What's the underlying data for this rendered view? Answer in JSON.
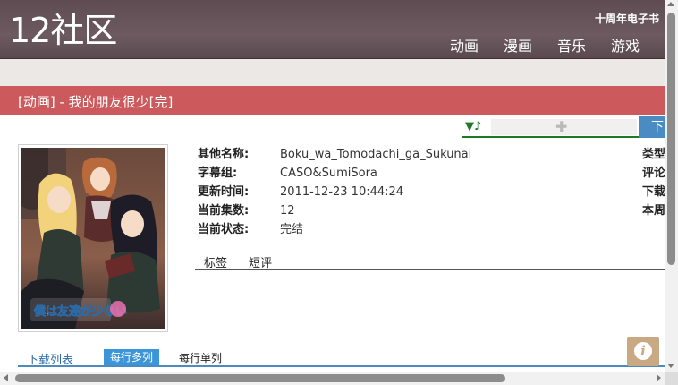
{
  "site": {
    "logo": "12社区",
    "tagline": "十周年电子书",
    "nav": [
      "动画",
      "漫画",
      "音乐",
      "游戏"
    ]
  },
  "page": {
    "title": "[动画] - 我的朋友很少[完]"
  },
  "toolbar": {
    "play_symbol": "▼♪",
    "plugin_icon": "puzzle-icon",
    "download_label": "下"
  },
  "info": {
    "rows": [
      {
        "label": "其他名称:",
        "value": "Boku_wa_Tomodachi_ga_Sukunai"
      },
      {
        "label": "字幕组:",
        "value": "CASO&SumiSora"
      },
      {
        "label": "更新时间:",
        "value": "2011-12-23 10:44:24"
      },
      {
        "label": "当前集数:",
        "value": "12"
      },
      {
        "label": "当前状态:",
        "value": "完结"
      }
    ],
    "right_labels": [
      "类型",
      "评论",
      "下载",
      "本周"
    ]
  },
  "subtabs": [
    "标签",
    "短评"
  ],
  "downloads": {
    "title": "下载列表",
    "mode_multi": "每行多列",
    "mode_single": "每行单列"
  },
  "cover": {
    "logo_text": "僕は友達が少ない"
  },
  "colors": {
    "header": "#5e4c52",
    "title_bar": "#cc5a5d",
    "accent_blue": "#4a8bc4",
    "accent_green": "#1f7a25"
  }
}
